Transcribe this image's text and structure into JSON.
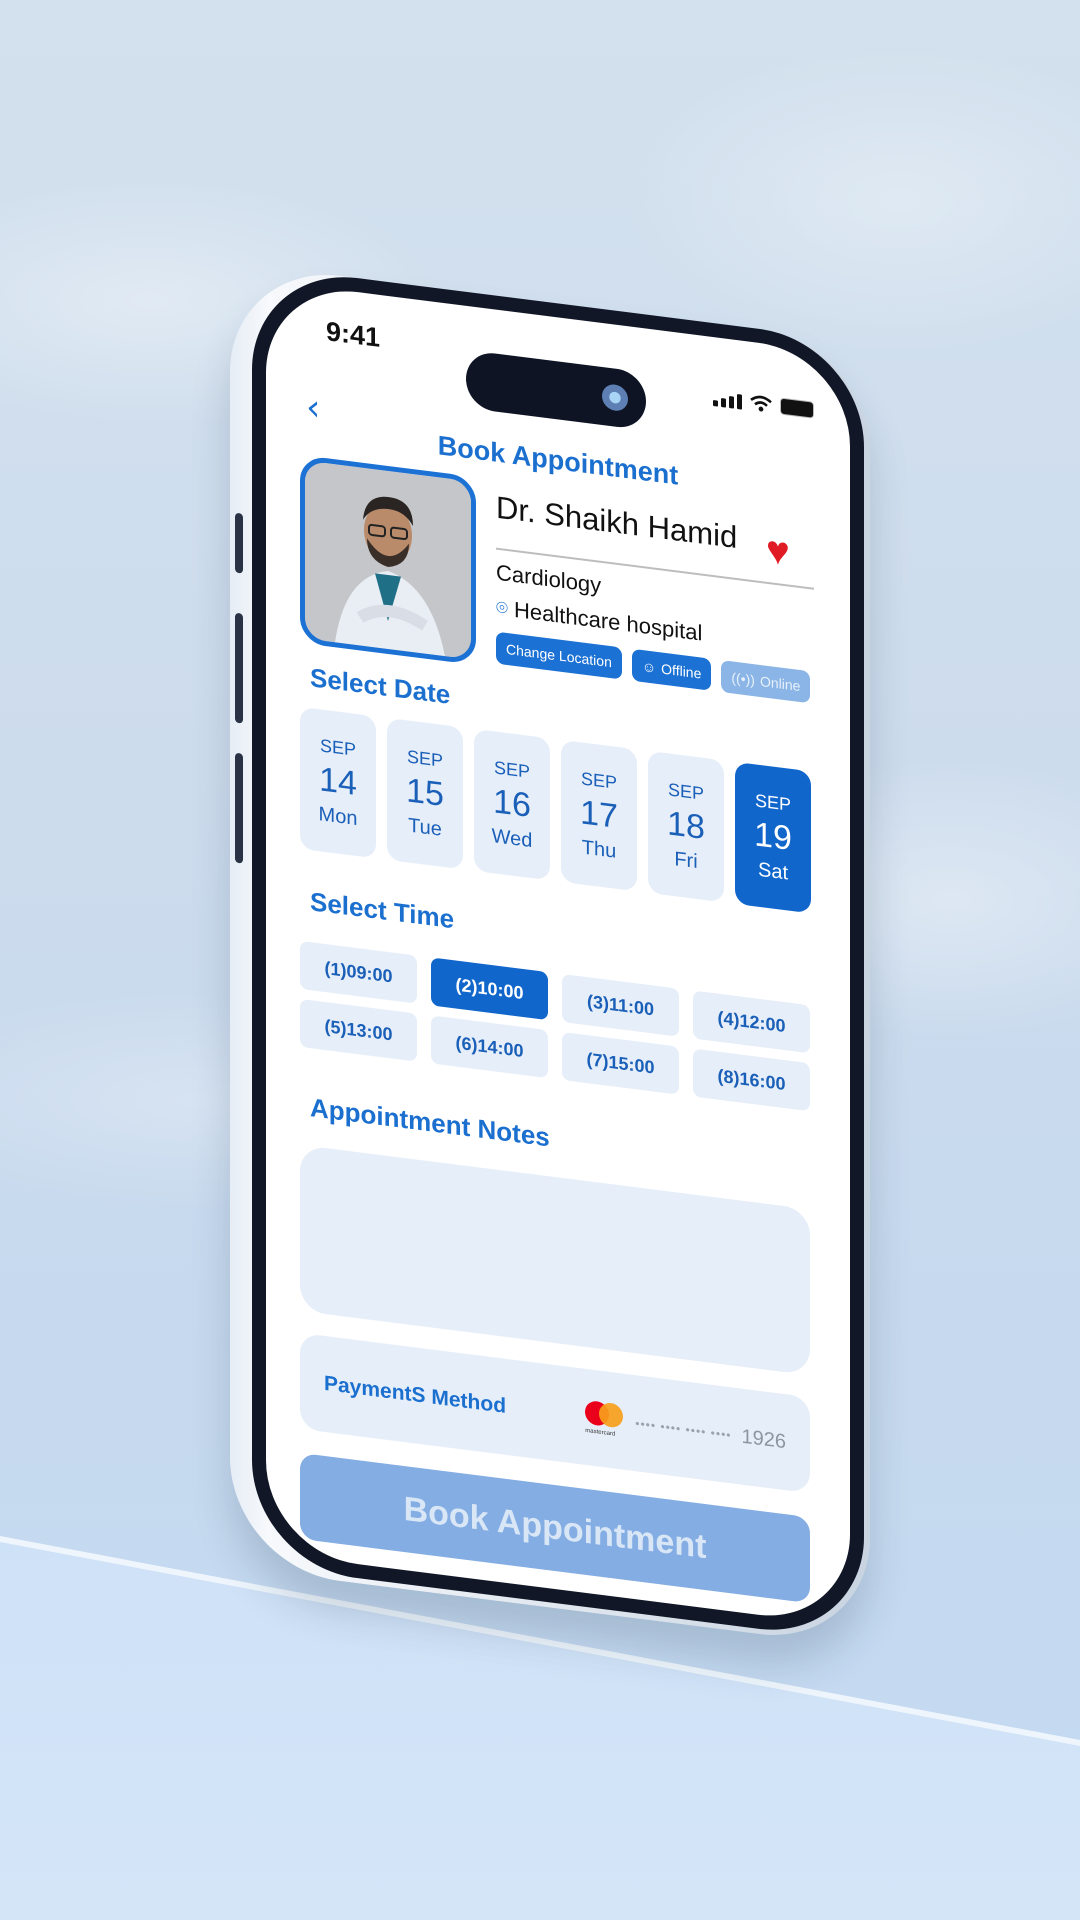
{
  "status_bar": {
    "time": "9:41"
  },
  "header": {
    "back_icon": "chevron-left-icon",
    "title": "Book Appointment"
  },
  "doctor": {
    "name": "Dr. Shaikh Hamid",
    "specialty": "Cardiology",
    "hospital": "Healthcare hospital",
    "favorite": true,
    "chips": [
      {
        "label": "Change Location",
        "active": true
      },
      {
        "label": "Offline",
        "icon": "person-icon",
        "active": true
      },
      {
        "label": "Online",
        "icon": "broadcast-icon",
        "active": false
      }
    ]
  },
  "select_date": {
    "title": "Select Date",
    "dates": [
      {
        "month": "SEP",
        "day": "14",
        "weekday": "Mon",
        "selected": false
      },
      {
        "month": "SEP",
        "day": "15",
        "weekday": "Tue",
        "selected": false
      },
      {
        "month": "SEP",
        "day": "16",
        "weekday": "Wed",
        "selected": false
      },
      {
        "month": "SEP",
        "day": "17",
        "weekday": "Thu",
        "selected": false
      },
      {
        "month": "SEP",
        "day": "18",
        "weekday": "Fri",
        "selected": false
      },
      {
        "month": "SEP",
        "day": "19",
        "weekday": "Sat",
        "selected": true
      }
    ]
  },
  "select_time": {
    "title": "Select Time",
    "slots": [
      {
        "label": "(1)09:00",
        "selected": false
      },
      {
        "label": "(2)10:00",
        "selected": true
      },
      {
        "label": "(3)11:00",
        "selected": false
      },
      {
        "label": "(4)12:00",
        "selected": false
      },
      {
        "label": "(5)13:00",
        "selected": false
      },
      {
        "label": "(6)14:00",
        "selected": false
      },
      {
        "label": "(7)15:00",
        "selected": false
      },
      {
        "label": "(8)16:00",
        "selected": false
      }
    ]
  },
  "notes": {
    "title": "Appointment Notes",
    "value": "",
    "placeholder": ""
  },
  "payment": {
    "label": "PaymentS Method",
    "card_brand": "mastercard",
    "masked": "•••• •••• •••• ••••",
    "last4": "1926"
  },
  "book_button": {
    "label": "Book Appointment",
    "enabled": false
  },
  "colors": {
    "primary": "#1166cc",
    "primary_light": "#e6eef9",
    "disabled": "#84ade3",
    "heart": "#e01b24"
  }
}
